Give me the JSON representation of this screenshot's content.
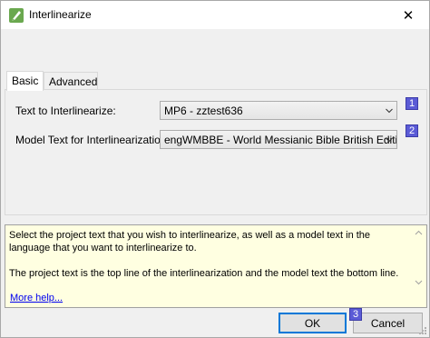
{
  "window": {
    "title": "Interlinearize",
    "close_glyph": "✕"
  },
  "tabs": [
    {
      "label": "Basic",
      "active": true
    },
    {
      "label": "Advanced",
      "active": false
    }
  ],
  "fields": {
    "text_label": "Text to Interlinearize:",
    "text_value": "MP6 -  zztest636",
    "model_label": "Model Text for Interlinearization:",
    "model_value": "engWMBBE -  World Messianic Bible British Edition"
  },
  "badges": [
    "1",
    "2",
    "3"
  ],
  "help": {
    "paragraph1": "Select the project text that you wish to interlinearize, as well as a model text in the language that you want to interlinearize to.",
    "paragraph2": "The project text is the top line of the interlinearization and the model text the bottom line.",
    "link": "More help..."
  },
  "buttons": {
    "ok": "OK",
    "cancel": "Cancel"
  },
  "colors": {
    "badge": "#5b5bd6",
    "help_background": "#ffffe1",
    "link": "#0000ee",
    "app_icon": "#6aa84f"
  },
  "icons": {
    "app": "pencil-icon",
    "close": "close-icon",
    "combo_arrow": "chevron-down-icon",
    "grip": "resize-grip-icon"
  }
}
